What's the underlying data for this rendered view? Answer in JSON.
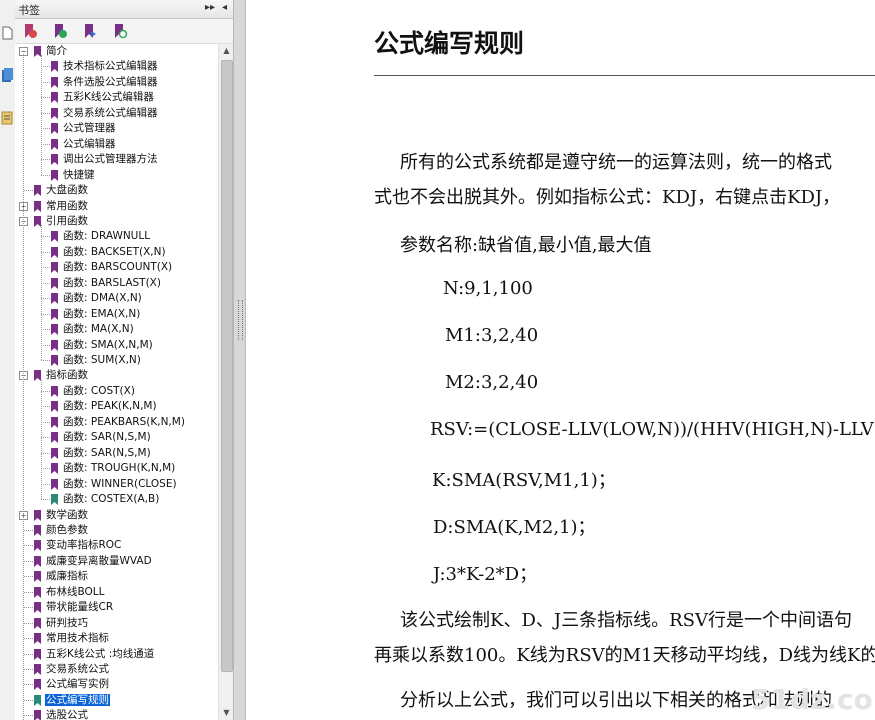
{
  "panel": {
    "title": "书签",
    "header_buttons": [
      "▸▸",
      "◂"
    ],
    "toolbar_icons": [
      "bookmark-options-icon",
      "expand-bookmark-icon",
      "new-bookmark-icon",
      "find-bookmark-icon"
    ]
  },
  "tree": [
    {
      "level": 0,
      "label": "简介",
      "toggle": "−",
      "color": "#7a2f86"
    },
    {
      "level": 1,
      "label": "技术指标公式编辑器",
      "color": "#7a2f86"
    },
    {
      "level": 1,
      "label": "条件选股公式编辑器",
      "color": "#7a2f86"
    },
    {
      "level": 1,
      "label": "五彩K线公式编辑器",
      "color": "#7a2f86"
    },
    {
      "level": 1,
      "label": "交易系统公式编辑器",
      "color": "#7a2f86"
    },
    {
      "level": 1,
      "label": "公式管理器",
      "color": "#7a2f86"
    },
    {
      "level": 1,
      "label": "公式编辑器",
      "color": "#7a2f86"
    },
    {
      "level": 1,
      "label": "调出公式管理器方法",
      "color": "#7a2f86"
    },
    {
      "level": 1,
      "label": "快捷键",
      "color": "#7a2f86"
    },
    {
      "level": 0,
      "label": "大盘函数",
      "color": "#7a2f86"
    },
    {
      "level": 0,
      "label": "常用函数",
      "toggle": "+",
      "color": "#7a2f86"
    },
    {
      "level": 0,
      "label": "引用函数",
      "toggle": "−",
      "color": "#7a2f86"
    },
    {
      "level": 1,
      "label": "函数: DRAWNULL",
      "color": "#7a2f86"
    },
    {
      "level": 1,
      "label": "函数: BACKSET(X,N)",
      "color": "#7a2f86"
    },
    {
      "level": 1,
      "label": "函数: BARSCOUNT(X)",
      "color": "#7a2f86"
    },
    {
      "level": 1,
      "label": "函数: BARSLAST(X)",
      "color": "#7a2f86"
    },
    {
      "level": 1,
      "label": "函数: DMA(X,N)",
      "color": "#7a2f86"
    },
    {
      "level": 1,
      "label": "函数: EMA(X,N)",
      "color": "#7a2f86"
    },
    {
      "level": 1,
      "label": "函数: MA(X,N)",
      "color": "#7a2f86"
    },
    {
      "level": 1,
      "label": "函数: SMA(X,N,M)",
      "color": "#7a2f86"
    },
    {
      "level": 1,
      "label": "函数: SUM(X,N)",
      "color": "#7a2f86"
    },
    {
      "level": 0,
      "label": "指标函数",
      "toggle": "−",
      "color": "#7a2f86"
    },
    {
      "level": 1,
      "label": "函数: COST(X)",
      "color": "#7a2f86"
    },
    {
      "level": 1,
      "label": "函数: PEAK(K,N,M)",
      "color": "#7a2f86"
    },
    {
      "level": 1,
      "label": "函数: PEAKBARS(K,N,M)",
      "color": "#7a2f86"
    },
    {
      "level": 1,
      "label": "函数: SAR(N,S,M)",
      "color": "#7a2f86"
    },
    {
      "level": 1,
      "label": "函数: SAR(N,S,M)",
      "color": "#7a2f86"
    },
    {
      "level": 1,
      "label": "函数: TROUGH(K,N,M)",
      "color": "#7a2f86"
    },
    {
      "level": 1,
      "label": "函数: WINNER(CLOSE)",
      "color": "#7a2f86"
    },
    {
      "level": 1,
      "label": "函数: COSTEX(A,B)",
      "color": "#2a8a78"
    },
    {
      "level": 0,
      "label": "数学函数",
      "toggle": "+",
      "color": "#7a2f86"
    },
    {
      "level": 0,
      "label": "颜色参数",
      "color": "#7a2f86"
    },
    {
      "level": 0,
      "label": "变动率指标ROC",
      "color": "#7a2f86"
    },
    {
      "level": 0,
      "label": "威廉变异离散量WVAD",
      "color": "#7a2f86"
    },
    {
      "level": 0,
      "label": "威廉指标",
      "color": "#7a2f86"
    },
    {
      "level": 0,
      "label": "布林线BOLL",
      "color": "#7a2f86"
    },
    {
      "level": 0,
      "label": "带状能量线CR",
      "color": "#7a2f86"
    },
    {
      "level": 0,
      "label": "研判技巧",
      "color": "#7a2f86"
    },
    {
      "level": 0,
      "label": "常用技术指标",
      "color": "#7a2f86"
    },
    {
      "level": 0,
      "label": "五彩K线公式 :均线通道",
      "color": "#7a2f86"
    },
    {
      "level": 0,
      "label": "交易系统公式",
      "color": "#7a2f86"
    },
    {
      "level": 0,
      "label": "公式编写实例",
      "color": "#7a2f86"
    },
    {
      "level": 0,
      "label": "公式编写规则",
      "color": "#2a8a78",
      "selected": true
    },
    {
      "level": 0,
      "label": "选股公式",
      "color": "#7a2f86"
    }
  ],
  "doc": {
    "title": "公式编写规则",
    "lines": [
      "所有的公式系统都是遵守统一的运算法则，统一的格式",
      "式也不会出脱其外。例如指标公式：KDJ，右键点击KDJ，",
      "参数名称:缺省值,最小值,最大值",
      "N:9,1,100",
      "M1:3,2,40",
      "M2:3,2,40",
      "RSV:=(CLOSE-LLV(LOW,N))/(HHV(HIGH,N)-LLV(LOW",
      "K:SMA(RSV,M1,1)；",
      "D:SMA(K,M2,1)；",
      "J:3*K-2*D；",
      "该公式绘制K、D、J三条指标线。RSV行是一个中间语句",
      "再乘以系数100。K线为RSV的M1天移动平均线，D线为线K的",
      "分析以上公式，我们可以引出以下相关的格式和法则的"
    ],
    "watermark": "51dz.com"
  }
}
